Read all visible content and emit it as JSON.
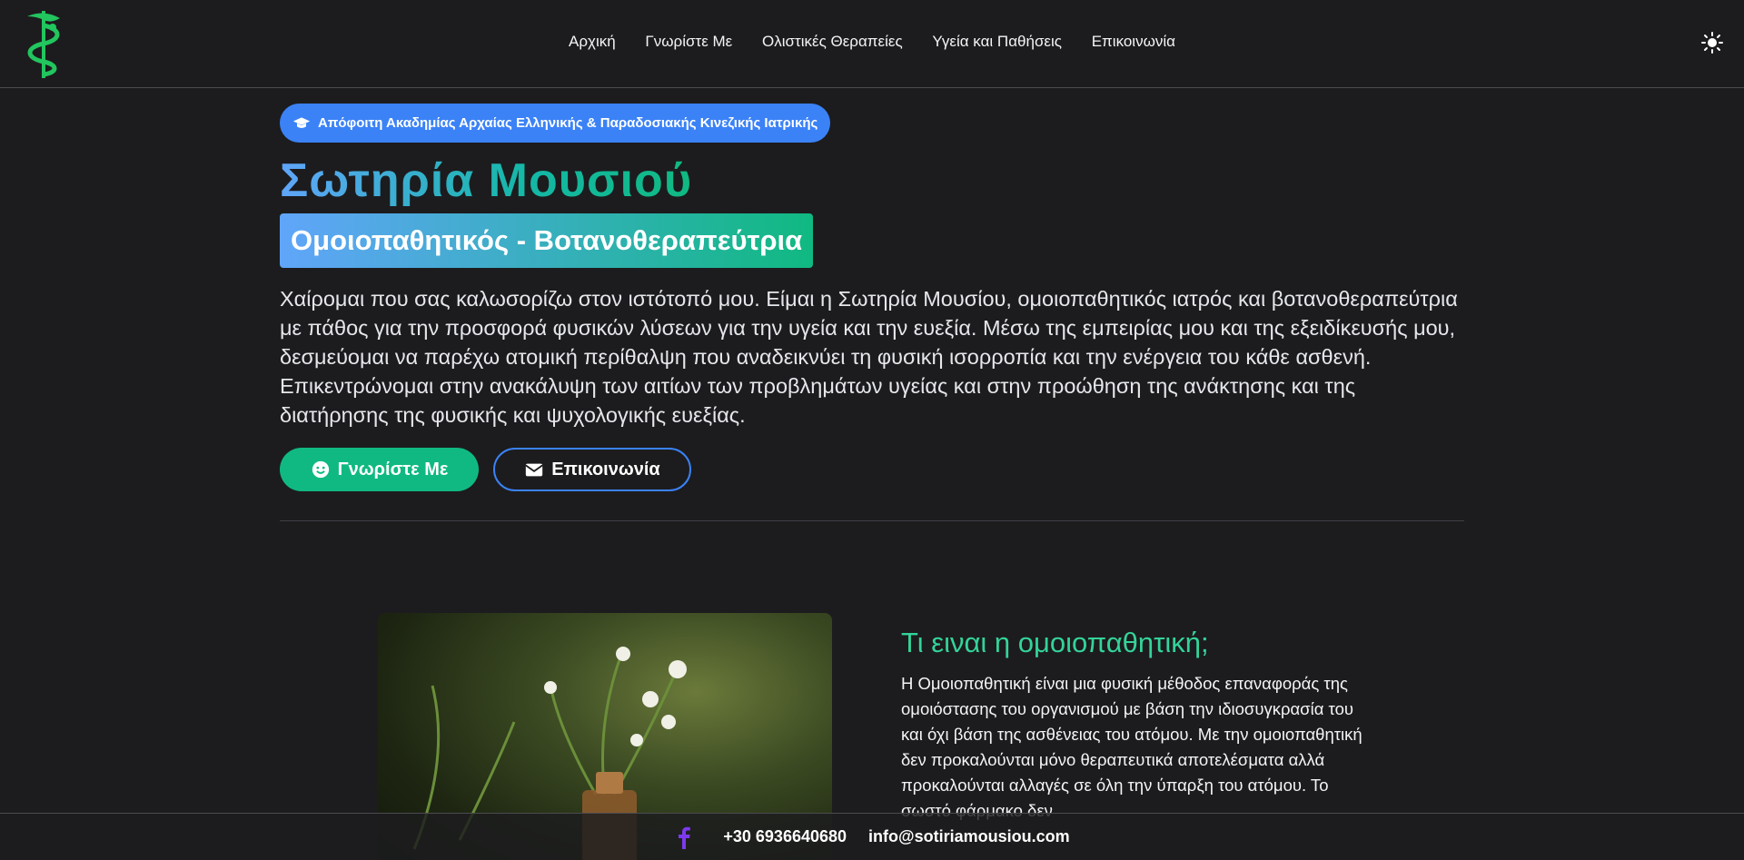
{
  "nav": {
    "items": [
      "Αρχική",
      "Γνωρίστε Με",
      "Ολιστικές Θεραπείες",
      "Υγεία και Παθήσεις",
      "Επικοινωνία"
    ]
  },
  "hero": {
    "badge": "Απόφοιτη Ακαδημίας Αρχαίας Ελληνικής & Παραδοσιακής Κινεζικής Ιατρικής",
    "name": "Σωτηρία Μουσιού",
    "role": "Ομοιοπαθητικός - Βοτανοθεραπεύτρια",
    "intro": "Χαίρομαι που σας καλωσορίζω στον ιστότοπό μου. Είμαι η Σωτηρία Μουσίου, ομοιοπαθητικός ιατρός και βοτανοθεραπεύτρια με πάθος για την προσφορά φυσικών λύσεων για την υγεία και την ευεξία. Μέσω της εμπειρίας μου και της εξειδίκευσής μου, δεσμεύομαι να παρέχω ατομική περίθαλψη που αναδεικνύει τη φυσική ισορροπία και την ενέργεια του κάθε ασθενή. Επικεντρώνομαι στην ανακάλυψη των αιτίων των προβλημάτων υγείας και στην προώθηση της ανάκτησης και της διατήρησης της φυσικής και ψυχολογικής ευεξίας.",
    "btn_about": "Γνωρίστε Με",
    "btn_contact": "Επικοινωνία"
  },
  "homeopathy": {
    "title": "Τι ειναι η ομοιοπαθητική;",
    "text": "Η Ομοιοπαθητική είναι μια φυσική μέθοδος επαναφοράς της ομοιόστασης του οργανισμού με βάση την ιδιοσυγκρασία του και όχι βάση της ασθένειας του ατόμου. Με την ομοιοπαθητική δεν προκαλούνται μόνο θεραπευτικά αποτελέσματα αλλά προκαλούνται αλλαγές σε όλη την ύπαρξη του ατόμου. Το σωστό φάρμακο δεν"
  },
  "footer": {
    "phone": "+30 6936640680",
    "email": "info@sotiriamousiou.com"
  },
  "colors": {
    "background": "#1c1c1e",
    "accent_blue": "#3b82f6",
    "accent_green": "#10b981",
    "logo_green": "#22c55e"
  },
  "icons": [
    "caduceus-logo",
    "sun-icon",
    "graduation-cap-icon",
    "smile-icon",
    "envelope-icon",
    "facebook-icon"
  ]
}
